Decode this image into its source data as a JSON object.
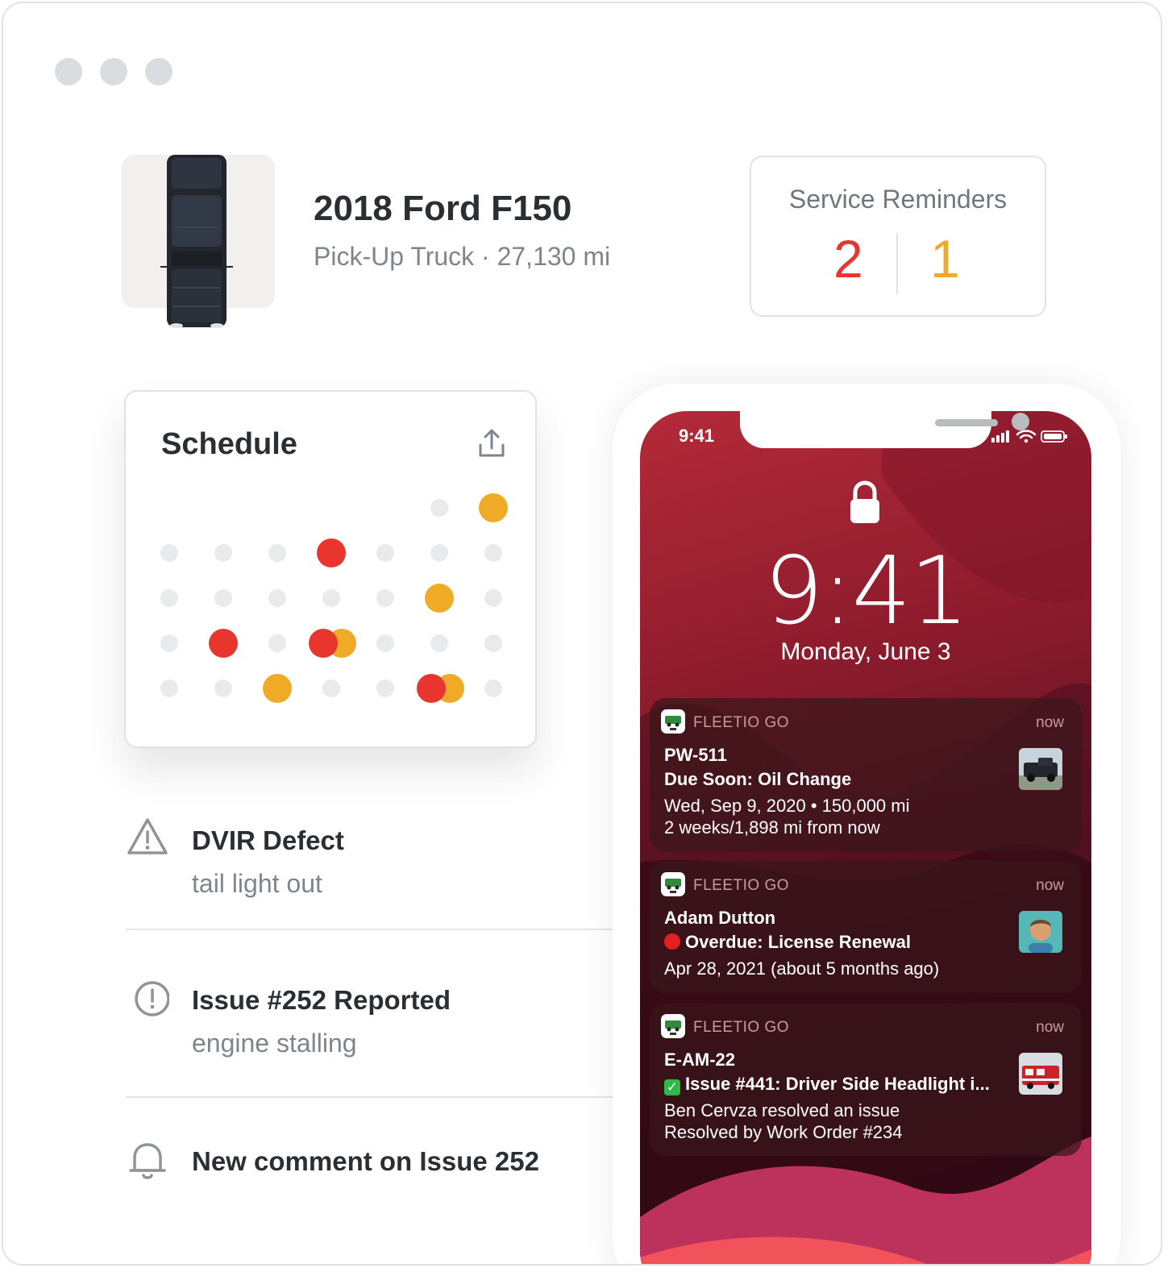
{
  "window": {
    "dots": [
      "",
      "",
      ""
    ]
  },
  "vehicle": {
    "name": "2018 Ford F150",
    "subtitle": "Pick-Up Truck · 27,130 mi"
  },
  "service_reminders": {
    "title": "Service Reminders",
    "overdue": "2",
    "due_soon": "1",
    "colors": {
      "overdue": "#e8352d",
      "due_soon": "#efaa26"
    }
  },
  "schedule": {
    "title": "Schedule",
    "share_icon": "share-icon",
    "legend_colors": {
      "empty": "#e8eaeb",
      "overdue": "#e8352d",
      "due_soon": "#efaa26"
    }
  },
  "feed": [
    {
      "icon": "warning-triangle-icon",
      "title": "DVIR Defect",
      "subtitle": "tail light out"
    },
    {
      "icon": "exclamation-circle-icon",
      "title": "Issue #252 Reported",
      "subtitle": "engine stalling"
    },
    {
      "icon": "bell-icon",
      "title": "New comment on Issue 252",
      "subtitle": ""
    }
  ],
  "phone": {
    "status_time": "9:41",
    "lock_time": "9:41",
    "lock_date": "Monday, June 3",
    "notifications": [
      {
        "app": "FLEETIO GO",
        "time": "now",
        "line1": "PW-511",
        "line2": "Due Soon: Oil Change",
        "line3": "Wed, Sep 9, 2020 • 150,000 mi",
        "line4": "2 weeks/1,898 mi from now",
        "thumb": "truck-photo"
      },
      {
        "app": "FLEETIO GO",
        "time": "now",
        "line1": "Adam Dutton",
        "line2": "Overdue: License Renewal",
        "line3": "Apr 28, 2021 (about 5 months ago)",
        "thumb": "avatar"
      },
      {
        "app": "FLEETIO GO",
        "time": "now",
        "line1": "E-AM-22",
        "line2": "Issue #441: Driver Side Headlight i...",
        "line3": "Ben Cervza resolved an issue",
        "line4": "Resolved by Work Order #234",
        "thumb": "ambulance-photo"
      }
    ]
  }
}
